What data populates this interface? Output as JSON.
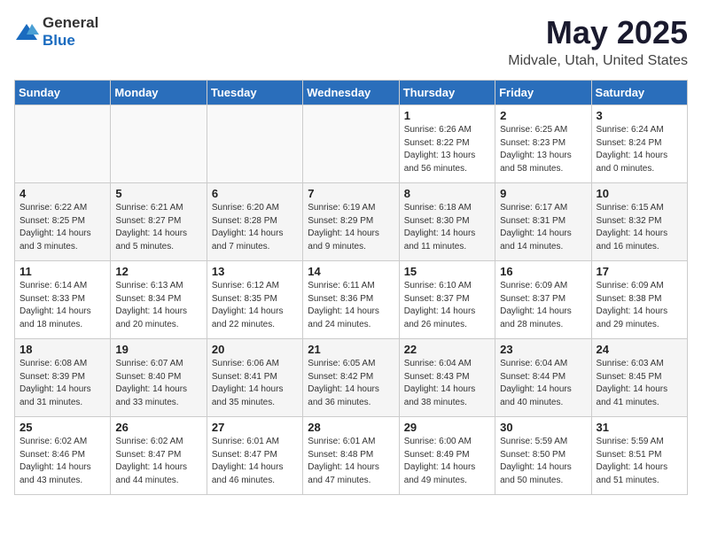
{
  "header": {
    "logo_general": "General",
    "logo_blue": "Blue",
    "title": "May 2025",
    "subtitle": "Midvale, Utah, United States"
  },
  "weekdays": [
    "Sunday",
    "Monday",
    "Tuesday",
    "Wednesday",
    "Thursday",
    "Friday",
    "Saturday"
  ],
  "weeks": [
    [
      {
        "day": "",
        "info": ""
      },
      {
        "day": "",
        "info": ""
      },
      {
        "day": "",
        "info": ""
      },
      {
        "day": "",
        "info": ""
      },
      {
        "day": "1",
        "info": "Sunrise: 6:26 AM\nSunset: 8:22 PM\nDaylight: 13 hours\nand 56 minutes."
      },
      {
        "day": "2",
        "info": "Sunrise: 6:25 AM\nSunset: 8:23 PM\nDaylight: 13 hours\nand 58 minutes."
      },
      {
        "day": "3",
        "info": "Sunrise: 6:24 AM\nSunset: 8:24 PM\nDaylight: 14 hours\nand 0 minutes."
      }
    ],
    [
      {
        "day": "4",
        "info": "Sunrise: 6:22 AM\nSunset: 8:25 PM\nDaylight: 14 hours\nand 3 minutes."
      },
      {
        "day": "5",
        "info": "Sunrise: 6:21 AM\nSunset: 8:27 PM\nDaylight: 14 hours\nand 5 minutes."
      },
      {
        "day": "6",
        "info": "Sunrise: 6:20 AM\nSunset: 8:28 PM\nDaylight: 14 hours\nand 7 minutes."
      },
      {
        "day": "7",
        "info": "Sunrise: 6:19 AM\nSunset: 8:29 PM\nDaylight: 14 hours\nand 9 minutes."
      },
      {
        "day": "8",
        "info": "Sunrise: 6:18 AM\nSunset: 8:30 PM\nDaylight: 14 hours\nand 11 minutes."
      },
      {
        "day": "9",
        "info": "Sunrise: 6:17 AM\nSunset: 8:31 PM\nDaylight: 14 hours\nand 14 minutes."
      },
      {
        "day": "10",
        "info": "Sunrise: 6:15 AM\nSunset: 8:32 PM\nDaylight: 14 hours\nand 16 minutes."
      }
    ],
    [
      {
        "day": "11",
        "info": "Sunrise: 6:14 AM\nSunset: 8:33 PM\nDaylight: 14 hours\nand 18 minutes."
      },
      {
        "day": "12",
        "info": "Sunrise: 6:13 AM\nSunset: 8:34 PM\nDaylight: 14 hours\nand 20 minutes."
      },
      {
        "day": "13",
        "info": "Sunrise: 6:12 AM\nSunset: 8:35 PM\nDaylight: 14 hours\nand 22 minutes."
      },
      {
        "day": "14",
        "info": "Sunrise: 6:11 AM\nSunset: 8:36 PM\nDaylight: 14 hours\nand 24 minutes."
      },
      {
        "day": "15",
        "info": "Sunrise: 6:10 AM\nSunset: 8:37 PM\nDaylight: 14 hours\nand 26 minutes."
      },
      {
        "day": "16",
        "info": "Sunrise: 6:09 AM\nSunset: 8:37 PM\nDaylight: 14 hours\nand 28 minutes."
      },
      {
        "day": "17",
        "info": "Sunrise: 6:09 AM\nSunset: 8:38 PM\nDaylight: 14 hours\nand 29 minutes."
      }
    ],
    [
      {
        "day": "18",
        "info": "Sunrise: 6:08 AM\nSunset: 8:39 PM\nDaylight: 14 hours\nand 31 minutes."
      },
      {
        "day": "19",
        "info": "Sunrise: 6:07 AM\nSunset: 8:40 PM\nDaylight: 14 hours\nand 33 minutes."
      },
      {
        "day": "20",
        "info": "Sunrise: 6:06 AM\nSunset: 8:41 PM\nDaylight: 14 hours\nand 35 minutes."
      },
      {
        "day": "21",
        "info": "Sunrise: 6:05 AM\nSunset: 8:42 PM\nDaylight: 14 hours\nand 36 minutes."
      },
      {
        "day": "22",
        "info": "Sunrise: 6:04 AM\nSunset: 8:43 PM\nDaylight: 14 hours\nand 38 minutes."
      },
      {
        "day": "23",
        "info": "Sunrise: 6:04 AM\nSunset: 8:44 PM\nDaylight: 14 hours\nand 40 minutes."
      },
      {
        "day": "24",
        "info": "Sunrise: 6:03 AM\nSunset: 8:45 PM\nDaylight: 14 hours\nand 41 minutes."
      }
    ],
    [
      {
        "day": "25",
        "info": "Sunrise: 6:02 AM\nSunset: 8:46 PM\nDaylight: 14 hours\nand 43 minutes."
      },
      {
        "day": "26",
        "info": "Sunrise: 6:02 AM\nSunset: 8:47 PM\nDaylight: 14 hours\nand 44 minutes."
      },
      {
        "day": "27",
        "info": "Sunrise: 6:01 AM\nSunset: 8:47 PM\nDaylight: 14 hours\nand 46 minutes."
      },
      {
        "day": "28",
        "info": "Sunrise: 6:01 AM\nSunset: 8:48 PM\nDaylight: 14 hours\nand 47 minutes."
      },
      {
        "day": "29",
        "info": "Sunrise: 6:00 AM\nSunset: 8:49 PM\nDaylight: 14 hours\nand 49 minutes."
      },
      {
        "day": "30",
        "info": "Sunrise: 5:59 AM\nSunset: 8:50 PM\nDaylight: 14 hours\nand 50 minutes."
      },
      {
        "day": "31",
        "info": "Sunrise: 5:59 AM\nSunset: 8:51 PM\nDaylight: 14 hours\nand 51 minutes."
      }
    ]
  ]
}
